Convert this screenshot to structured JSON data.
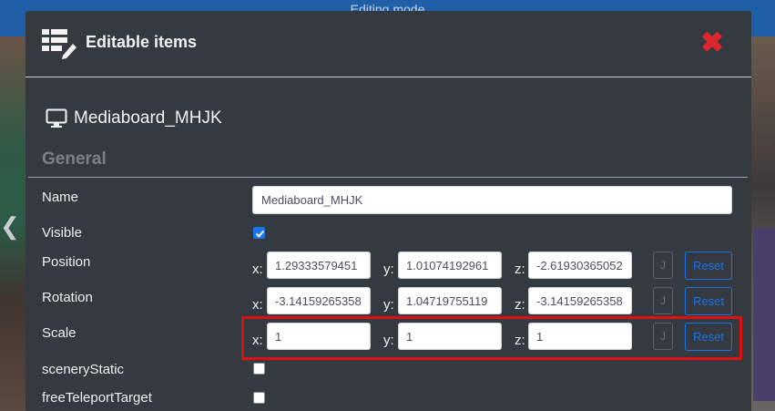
{
  "background": {
    "topbar_text": "Editing mode"
  },
  "modal": {
    "title": "Editable items",
    "close_icon": "close-x-icon",
    "item_name": "Mediaboard_MHJK",
    "section": "General",
    "fields": {
      "name": {
        "label": "Name",
        "value": "Mediaboard_MHJK"
      },
      "visible": {
        "label": "Visible",
        "checked": true
      },
      "position": {
        "label": "Position",
        "x": "1.29333579451",
        "y": "1.01074192961",
        "z": "-2.61930365052",
        "j": "J",
        "reset": "Reset"
      },
      "rotation": {
        "label": "Rotation",
        "x": "-3.14159265358",
        "y": "1.04719755119",
        "z": "-3.14159265358",
        "j": "J",
        "reset": "Reset"
      },
      "scale": {
        "label": "Scale",
        "x": "1",
        "y": "1",
        "z": "1",
        "j": "J",
        "reset": "Reset"
      },
      "scenery_static": {
        "label": "sceneryStatic",
        "checked": false
      },
      "free_teleport_target": {
        "label": "freeTeleportTarget",
        "checked": false
      }
    },
    "axis_labels": {
      "x": "x:",
      "y": "y:",
      "z": "z:"
    }
  },
  "colors": {
    "modal_bg": "#343a40",
    "accent_blue": "#1a73e8",
    "close_red": "#e0262d",
    "highlight_red": "#e01010",
    "topbar_blue": "#1f5fa8"
  }
}
